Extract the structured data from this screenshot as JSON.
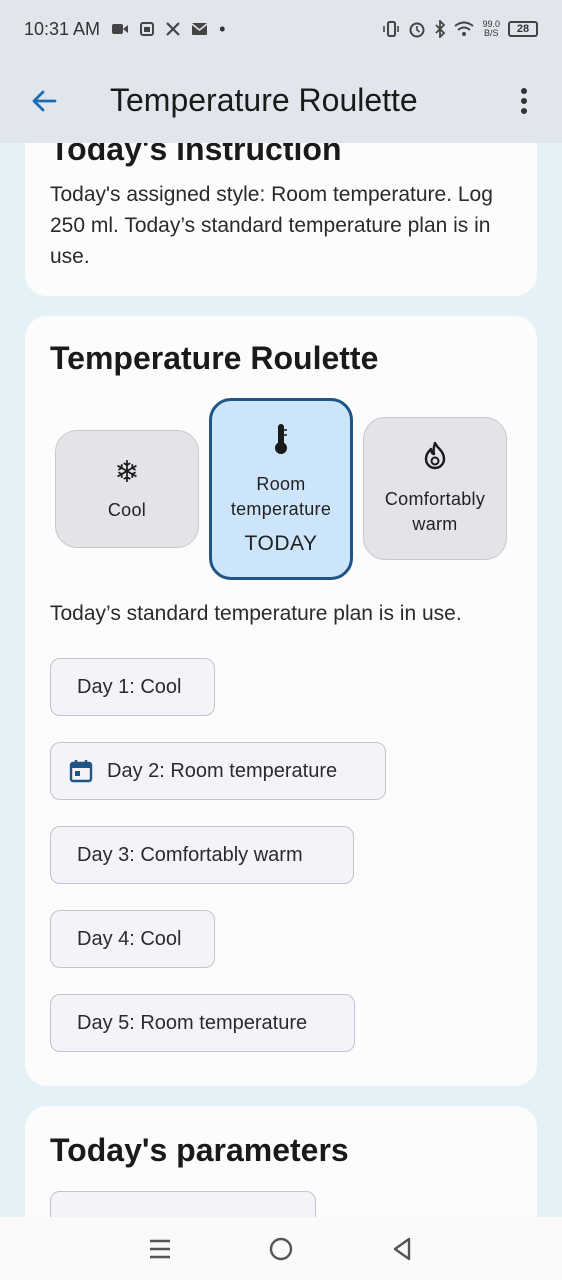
{
  "status_bar": {
    "time": "10:31 AM",
    "battery": "28",
    "speed_top": "99.0",
    "speed_bottom": "B/S",
    "dot": "•"
  },
  "app_bar": {
    "title": "Temperature Roulette",
    "back_icon": "arrow-back-icon",
    "more_icon": "more-vert-icon"
  },
  "instruction_card": {
    "heading": "Today's instruction",
    "text": "Today's assigned style: Room temperature. Log 250 ml. Today’s standard temperature plan is in use."
  },
  "roulette_card": {
    "heading": "Temperature Roulette",
    "options": [
      {
        "label": "Cool",
        "icon": "snowflake-icon",
        "glyph": "❄"
      },
      {
        "label": "Room temperature",
        "icon": "thermometer-icon",
        "badge": "TODAY"
      },
      {
        "label": "Comfortably warm",
        "icon": "flame-icon"
      }
    ],
    "plan_text": "Today’s standard temperature plan is in use.",
    "days": [
      "Day 1: Cool",
      "Day 2: Room temperature",
      "Day 3: Comfortably warm",
      "Day 4: Cool",
      "Day 5: Room temperature"
    ],
    "selected_day_icon": "calendar-icon"
  },
  "parameters_card": {
    "heading": "Today's parameters"
  },
  "colors": {
    "selected_fill": "#cde5fb",
    "selected_border": "#1f5584",
    "accent": "#1e6bb0"
  }
}
